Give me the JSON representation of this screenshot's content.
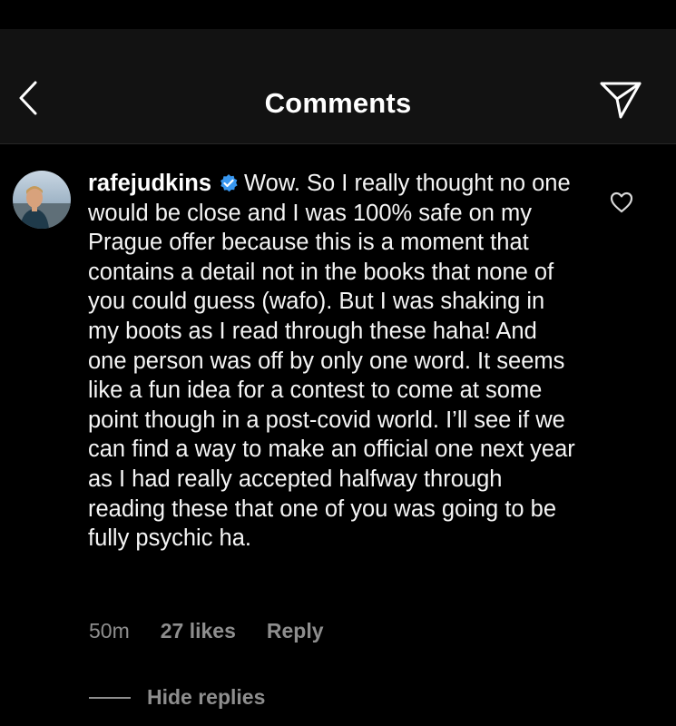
{
  "header": {
    "title": "Comments",
    "back_icon": "chevron-left-icon",
    "send_icon": "paper-plane-icon"
  },
  "comment": {
    "username": "rafejudkins",
    "verified": true,
    "text": "Wow.  So I really thought no one would be close and I was 100% safe on my Prague offer because this is a moment that contains a detail not in the books that none of you could guess (wafo). But I was shaking in my boots as I read through these haha!  And one person was off by only one word.  It seems like a fun idea for a contest to come at some point though in a post-covid world.  I’ll see if we can find a way to make an official one next year as I had really accepted halfway through reading these that one of you was going to be fully psychic ha.",
    "time": "50m",
    "likes": "27 likes",
    "reply_label": "Reply",
    "hide_replies_label": "Hide replies"
  },
  "colors": {
    "background": "#000000",
    "header_bg": "#121212",
    "text": "#f5f5f5",
    "secondary_text": "#8e8e8e",
    "verified_blue": "#3897f0"
  }
}
